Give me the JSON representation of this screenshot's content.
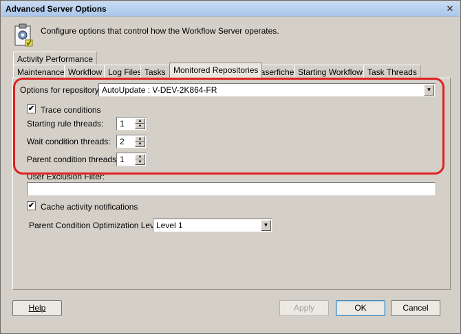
{
  "window": {
    "title": "Advanced Server Options"
  },
  "header": {
    "description": "Configure options that control how the Workflow Server operates."
  },
  "tabs": {
    "row1": [
      {
        "label": "Activity Performance"
      }
    ],
    "row2": [
      {
        "label": "Maintenance"
      },
      {
        "label": "Workflow"
      },
      {
        "label": "Log Files"
      },
      {
        "label": "Tasks"
      },
      {
        "label": "Monitored Repositories",
        "active": true
      },
      {
        "label": "Laserfiche"
      },
      {
        "label": "Starting Workflows"
      },
      {
        "label": "Task Threads"
      }
    ]
  },
  "panel": {
    "repository_label": "Options for repository:",
    "repository_value": "AutoUpdate : V-DEV-2K864-FR",
    "trace_conditions": {
      "label": "Trace conditions",
      "checked": true
    },
    "starting_rule_threads": {
      "label": "Starting rule threads:",
      "value": "1"
    },
    "wait_condition_threads": {
      "label": "Wait condition threads:",
      "value": "2"
    },
    "parent_condition_threads": {
      "label": "Parent condition threads:",
      "value": "1"
    },
    "user_exclusion_filter": {
      "label": "User Exclusion Filter:",
      "value": ""
    },
    "cache_activity_notifications": {
      "label": "Cache activity notifications",
      "checked": true
    },
    "parent_optimization": {
      "label": "Parent Condition Optimization Level:",
      "value": "Level 1"
    }
  },
  "buttons": {
    "help": "Help",
    "apply": "Apply",
    "ok": "OK",
    "cancel": "Cancel"
  },
  "colors": {
    "highlight": "#e02020"
  }
}
